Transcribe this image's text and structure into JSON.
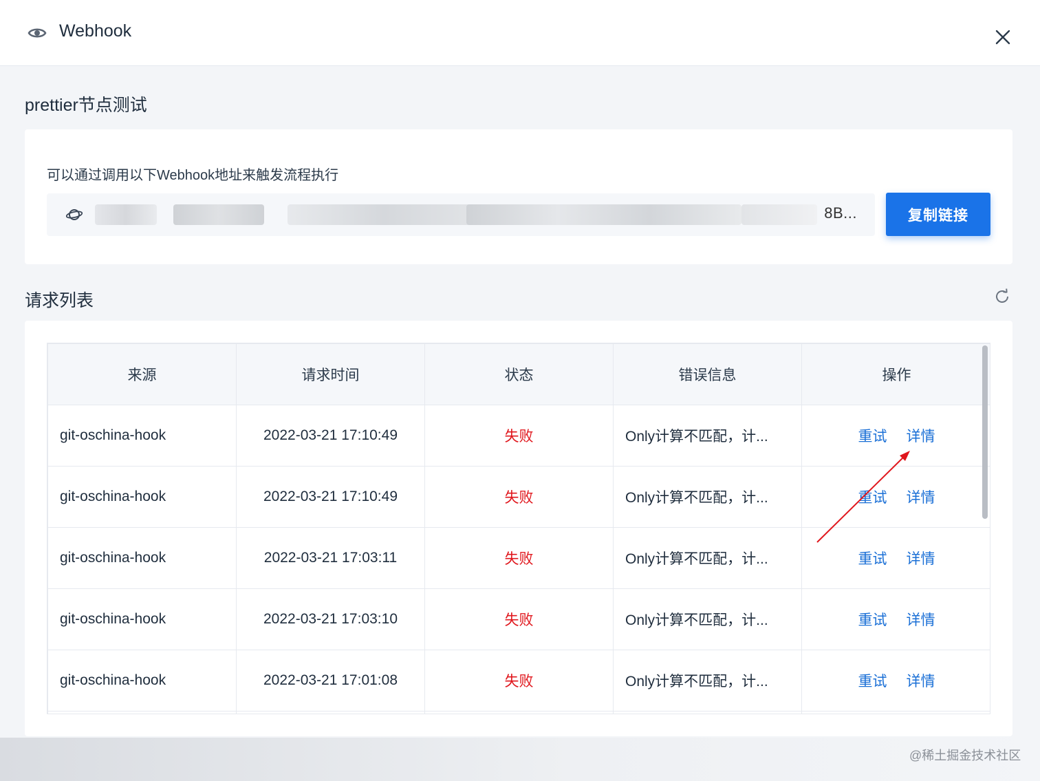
{
  "header": {
    "title": "Webhook",
    "eye_icon": "eye-icon",
    "close_icon": "close-icon"
  },
  "flow_name": "prettier节点测试",
  "webhook": {
    "hint": "可以通过调用以下Webhook地址来触发流程执行",
    "url_visible_tail": "8B...",
    "copy_button": "复制链接",
    "icon": "planet-icon"
  },
  "requests": {
    "title": "请求列表",
    "refresh_icon": "refresh-icon",
    "columns": [
      "来源",
      "请求时间",
      "状态",
      "错误信息",
      "操作"
    ],
    "rows": [
      {
        "source": "git-oschina-hook",
        "time": "2022-03-21 17:10:49",
        "status": "失败",
        "error": "Only计算不匹配，计...",
        "retry": "重试",
        "detail": "详情"
      },
      {
        "source": "git-oschina-hook",
        "time": "2022-03-21 17:10:49",
        "status": "失败",
        "error": "Only计算不匹配，计...",
        "retry": "重试",
        "detail": "详情"
      },
      {
        "source": "git-oschina-hook",
        "time": "2022-03-21 17:03:11",
        "status": "失败",
        "error": "Only计算不匹配，计...",
        "retry": "重试",
        "detail": "详情"
      },
      {
        "source": "git-oschina-hook",
        "time": "2022-03-21 17:03:10",
        "status": "失败",
        "error": "Only计算不匹配，计...",
        "retry": "重试",
        "detail": "详情"
      },
      {
        "source": "git-oschina-hook",
        "time": "2022-03-21 17:01:08",
        "status": "失败",
        "error": "Only计算不匹配，计...",
        "retry": "重试",
        "detail": "详情"
      }
    ]
  },
  "watermark": "@稀土掘金技术社区",
  "colors": {
    "primary": "#1a73e8",
    "link": "#1a6fd6",
    "fail": "#e0161c",
    "annotation_arrow": "#e0161c"
  }
}
